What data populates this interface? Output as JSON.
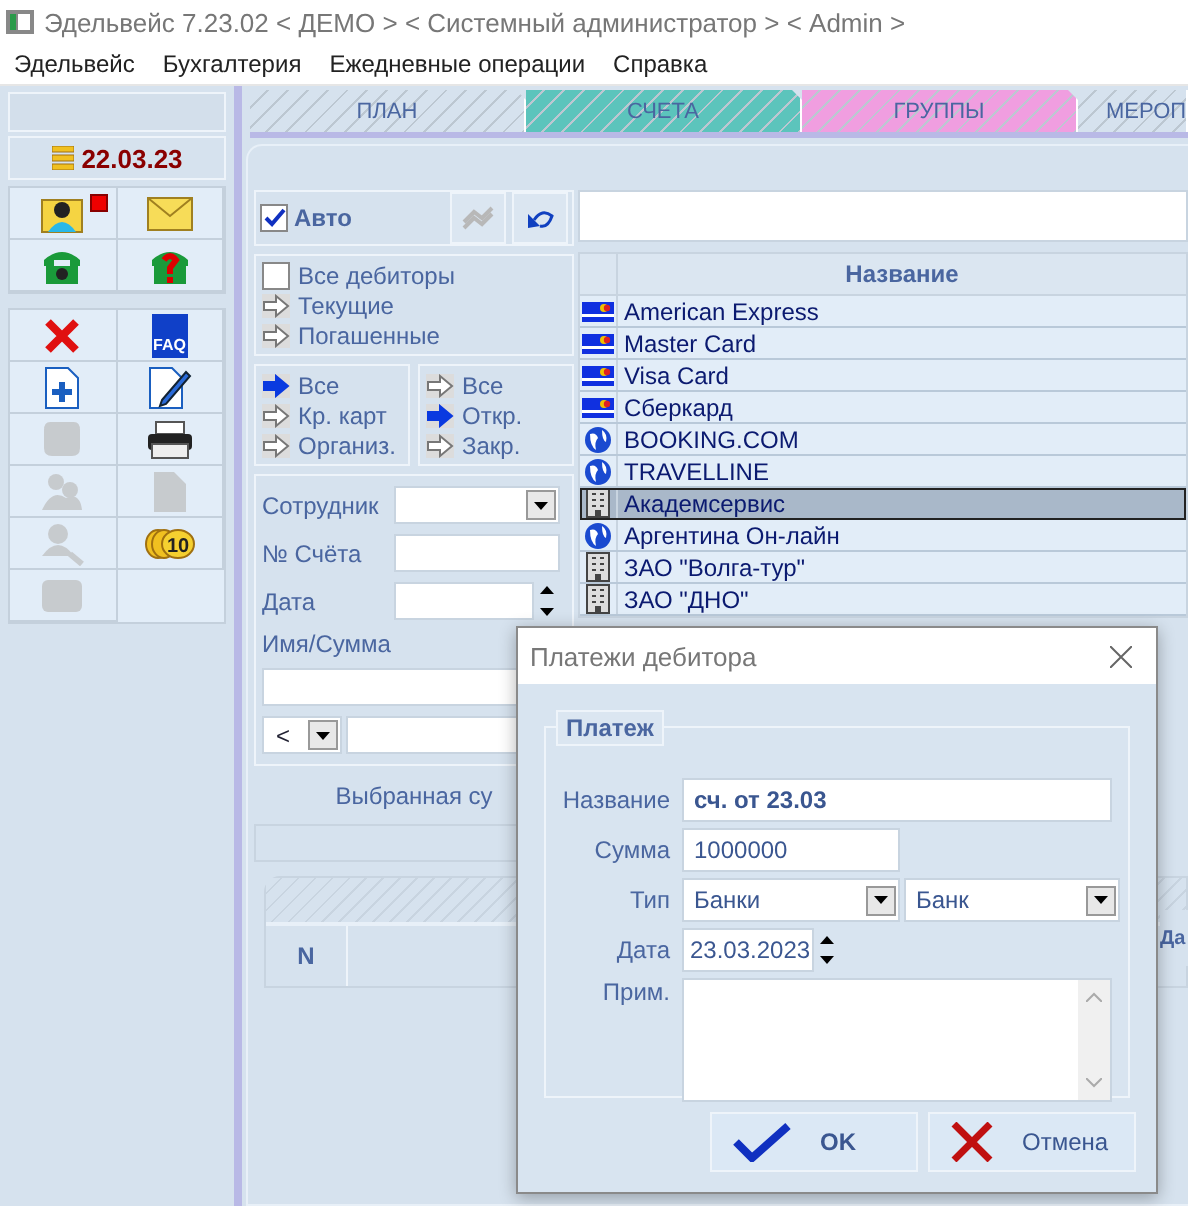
{
  "window": {
    "title": "Эдельвейс 7.23.02 < ДЕМО > < Системный администратор > < Admin >"
  },
  "menu": [
    {
      "label": "Эдельвейс"
    },
    {
      "label": "Бухгалтерия"
    },
    {
      "label": "Ежедневные операции"
    },
    {
      "label": "Справка"
    }
  ],
  "sidebar": {
    "date": "22.03.23",
    "top_tools": [
      {
        "kind": "contact",
        "badge": true
      },
      {
        "kind": "mail",
        "badge": false
      },
      {
        "kind": "phone",
        "badge": false
      },
      {
        "kind": "help-phone",
        "badge": false
      }
    ],
    "tools": [
      {
        "kind": "delete",
        "disabled": false
      },
      {
        "kind": "faq",
        "disabled": false,
        "label": "FAQ"
      },
      {
        "kind": "add-doc",
        "disabled": false
      },
      {
        "kind": "edit-doc",
        "disabled": false
      },
      {
        "kind": "chat",
        "disabled": true
      },
      {
        "kind": "print",
        "disabled": false
      },
      {
        "kind": "users",
        "disabled": true
      },
      {
        "kind": "page",
        "disabled": true
      },
      {
        "kind": "user-search",
        "disabled": true
      },
      {
        "kind": "coins",
        "disabled": false,
        "label": "10"
      },
      {
        "kind": "note",
        "disabled": true
      }
    ]
  },
  "tabs": [
    {
      "label": "ПЛАН",
      "color": "#d6e2ee"
    },
    {
      "label": "СЧЕТА",
      "color": "#5cc4bc"
    },
    {
      "label": "ГРУППЫ",
      "color": "#f09ee0"
    },
    {
      "label": "МЕРОП",
      "color": "#d6e2ee"
    }
  ],
  "filters": {
    "auto": {
      "label": "Авто",
      "checked": true
    },
    "refresh_disabled": true,
    "all_debtors": {
      "label": "Все дебиторы",
      "checked": false
    },
    "debtor_options": [
      {
        "label": "Текущие",
        "selected": false
      },
      {
        "label": "Погашенные",
        "selected": false
      }
    ],
    "type_options": [
      {
        "label": "Все",
        "selected": true
      },
      {
        "label": "Кр. карт",
        "selected": false
      },
      {
        "label": "Организ.",
        "selected": false
      }
    ],
    "state_options": [
      {
        "label": "Все",
        "selected": false
      },
      {
        "label": "Откр.",
        "selected": true
      },
      {
        "label": "Закр.",
        "selected": false
      }
    ],
    "employee_label": "Сотрудник",
    "account_label": "№ Счёта",
    "date_label": "Дата",
    "name_sum_label": "Имя/Сумма",
    "compare": "<",
    "selected_sum_label": "Выбранная су"
  },
  "payments_table": {
    "columns": [
      "N",
      "Да"
    ]
  },
  "debtors": {
    "header": "Название",
    "rows": [
      {
        "name": "American Express",
        "kind": "card",
        "selected": false
      },
      {
        "name": "Master Card",
        "kind": "card",
        "selected": false
      },
      {
        "name": "Visa Card",
        "kind": "card",
        "selected": false
      },
      {
        "name": "Сберкард",
        "kind": "card",
        "selected": false
      },
      {
        "name": "BOOKING.COM",
        "kind": "web",
        "selected": false
      },
      {
        "name": "TRAVELLINE",
        "kind": "web",
        "selected": false
      },
      {
        "name": "Академсервис",
        "kind": "org",
        "selected": true
      },
      {
        "name": "Аргентина Он-лайн",
        "kind": "web",
        "selected": false
      },
      {
        "name": "ЗАО \"Волга-тур\"",
        "kind": "org",
        "selected": false
      },
      {
        "name": "ЗАО \"ДНО\"",
        "kind": "org",
        "selected": false
      }
    ]
  },
  "dialog": {
    "title": "Платежи дебитора",
    "group": "Платеж",
    "name_label": "Название",
    "name": "сч. от 23.03",
    "sum_label": "Сумма",
    "sum": "1000000",
    "type_label": "Тип",
    "type": "Банки",
    "subtype": "Банк",
    "date_label": "Дата",
    "date": "23.03.2023",
    "note_label": "Прим.",
    "ok": "OK",
    "cancel": "Отмена"
  }
}
